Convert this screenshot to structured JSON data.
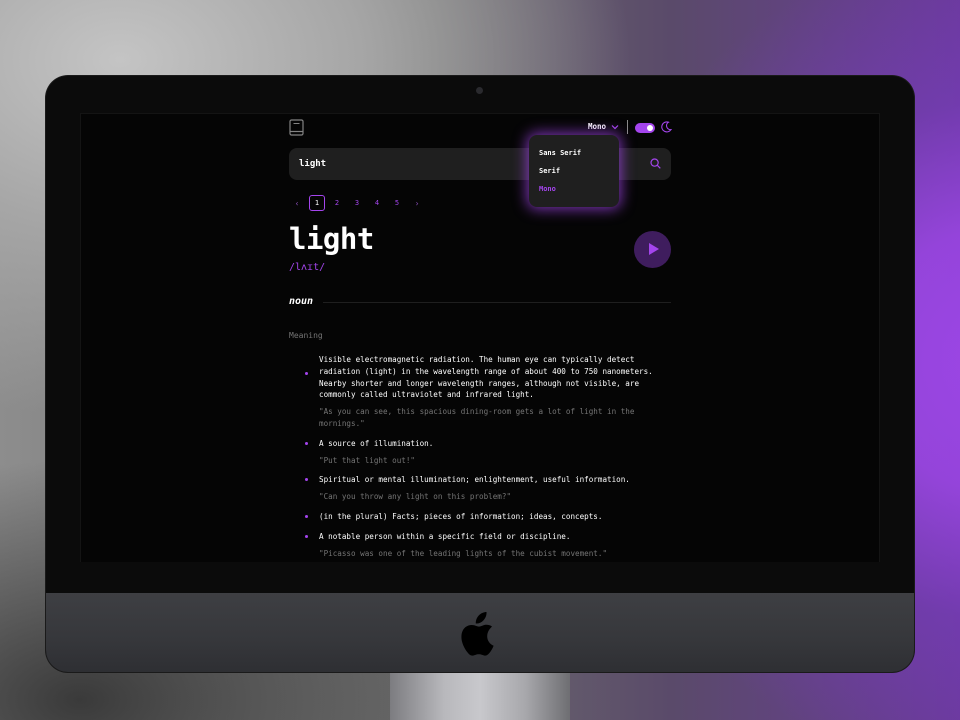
{
  "header": {
    "font_selected": "Mono",
    "theme_dark": true
  },
  "font_menu": {
    "options": [
      "Sans Serif",
      "Serif",
      "Mono"
    ],
    "selected": "Mono"
  },
  "search": {
    "value": "light"
  },
  "pagination": {
    "prev": "‹",
    "pages": [
      "1",
      "2",
      "3",
      "4",
      "5"
    ],
    "active_page": "1",
    "next": "›"
  },
  "entry": {
    "word": "light",
    "phonetic": "/lʌɪt/",
    "part_of_speech": "noun",
    "meaning_label": "Meaning",
    "definitions": [
      {
        "text": "Visible electromagnetic radiation. The human eye can typically detect radiation (light) in the wavelength range of about 400 to 750 nanometers. Nearby shorter and longer wavelength ranges, although not visible, are commonly called ultraviolet and infrared light.",
        "example": "\"As you can see, this spacious dining-room gets a lot of light in the mornings.\""
      },
      {
        "text": "A source of illumination.",
        "example": "\"Put that light out!\""
      },
      {
        "text": "Spiritual or mental illumination; enlightenment, useful information.",
        "example": "\"Can you throw any light on this problem?\""
      },
      {
        "text": "(in the plural) Facts; pieces of information; ideas, concepts.",
        "example": ""
      },
      {
        "text": "A notable person within a specific field or discipline.",
        "example": "\"Picasso was one of the leading lights of the cubist movement.\""
      }
    ]
  },
  "colors": {
    "accent": "#a445ed",
    "background": "#050505",
    "surface": "#1f1f1f",
    "muted_text": "#757575"
  }
}
